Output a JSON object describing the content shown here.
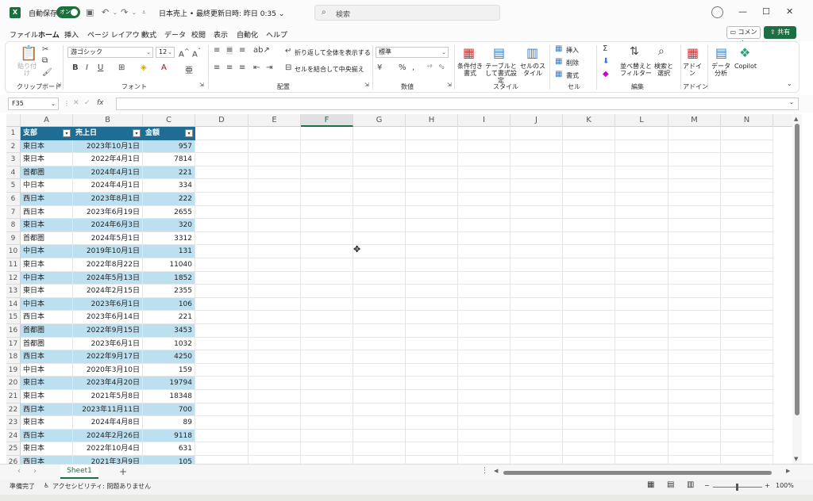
{
  "titlebar": {
    "app_icon": "X",
    "autosave_label": "自動保存",
    "autosave_state": "オン",
    "doc_title": "日本売上 • 最終更新日時: 昨日 0:35 ⌄",
    "search_placeholder": "検索"
  },
  "menu": {
    "tabs": [
      "ファイル",
      "ホーム",
      "挿入",
      "ページ レイアウト",
      "数式",
      "データ",
      "校閲",
      "表示",
      "自動化",
      "ヘルプ"
    ],
    "active": "ホーム",
    "comment_label": "コメント",
    "share_label": "共有"
  },
  "ribbon": {
    "clipboard": {
      "paste": "貼り付け",
      "label": "クリップボード"
    },
    "font": {
      "name": "游ゴシック",
      "size": "12",
      "label": "フォント"
    },
    "alignment": {
      "wrap": "折り返して全体を表示する",
      "merge": "セルを結合して中央揃え",
      "label": "配置"
    },
    "number": {
      "format": "標準",
      "label": "数値"
    },
    "styles": {
      "conditional": "条件付き書式",
      "table": "テーブルとして書式設定",
      "cell": "セルのスタイル",
      "label": "スタイル"
    },
    "cells": {
      "insert": "挿入",
      "delete": "削除",
      "format": "書式",
      "label": "セル"
    },
    "editing": {
      "sort": "並べ替えとフィルター",
      "find": "検索と選択",
      "label": "編集"
    },
    "addins": {
      "addin": "アドイン",
      "label": "アドイン"
    },
    "analysis": {
      "data": "データ分析",
      "copilot": "Copilot"
    }
  },
  "formula": {
    "namebox": "F35",
    "fx": "fx",
    "value": ""
  },
  "grid": {
    "columns": [
      "A",
      "B",
      "C",
      "D",
      "E",
      "F",
      "G",
      "H",
      "I",
      "J",
      "K",
      "L",
      "M",
      "N"
    ],
    "selected_column": "F",
    "headers": [
      "支部",
      "売上日",
      "金額"
    ],
    "rows": [
      [
        "東日本",
        "2023年10月1日",
        "957"
      ],
      [
        "東日本",
        "2022年4月1日",
        "7814"
      ],
      [
        "首都圏",
        "2024年4月1日",
        "221"
      ],
      [
        "中日本",
        "2024年4月1日",
        "334"
      ],
      [
        "西日本",
        "2023年8月1日",
        "222"
      ],
      [
        "西日本",
        "2023年6月19日",
        "2655"
      ],
      [
        "東日本",
        "2024年6月3日",
        "320"
      ],
      [
        "首都圏",
        "2024年5月1日",
        "3312"
      ],
      [
        "中日本",
        "2019年10月1日",
        "131"
      ],
      [
        "東日本",
        "2022年8月22日",
        "11040"
      ],
      [
        "中日本",
        "2024年5月13日",
        "1852"
      ],
      [
        "東日本",
        "2024年2月15日",
        "2355"
      ],
      [
        "中日本",
        "2023年6月1日",
        "106"
      ],
      [
        "西日本",
        "2023年6月14日",
        "221"
      ],
      [
        "首都圏",
        "2022年9月15日",
        "3453"
      ],
      [
        "首都圏",
        "2023年6月1日",
        "1032"
      ],
      [
        "西日本",
        "2022年9月17日",
        "4250"
      ],
      [
        "中日本",
        "2020年3月10日",
        "159"
      ],
      [
        "東日本",
        "2023年4月20日",
        "19794"
      ],
      [
        "東日本",
        "2021年5月8日",
        "18348"
      ],
      [
        "西日本",
        "2023年11月11日",
        "700"
      ],
      [
        "東日本",
        "2024年4月8日",
        "89"
      ],
      [
        "西日本",
        "2024年2月26日",
        "9118"
      ],
      [
        "東日本",
        "2022年10月4日",
        "631"
      ],
      [
        "西日本",
        "2021年3月9日",
        "105"
      ]
    ]
  },
  "sheet": {
    "tab": "Sheet1"
  },
  "status": {
    "ready": "準備完了",
    "accessibility": "アクセシビリティ: 問題ありません",
    "zoom": "100%"
  },
  "colors": {
    "excel_green": "#1d6f42",
    "table_header": "#1f6d94",
    "band": "#bde0f0"
  }
}
